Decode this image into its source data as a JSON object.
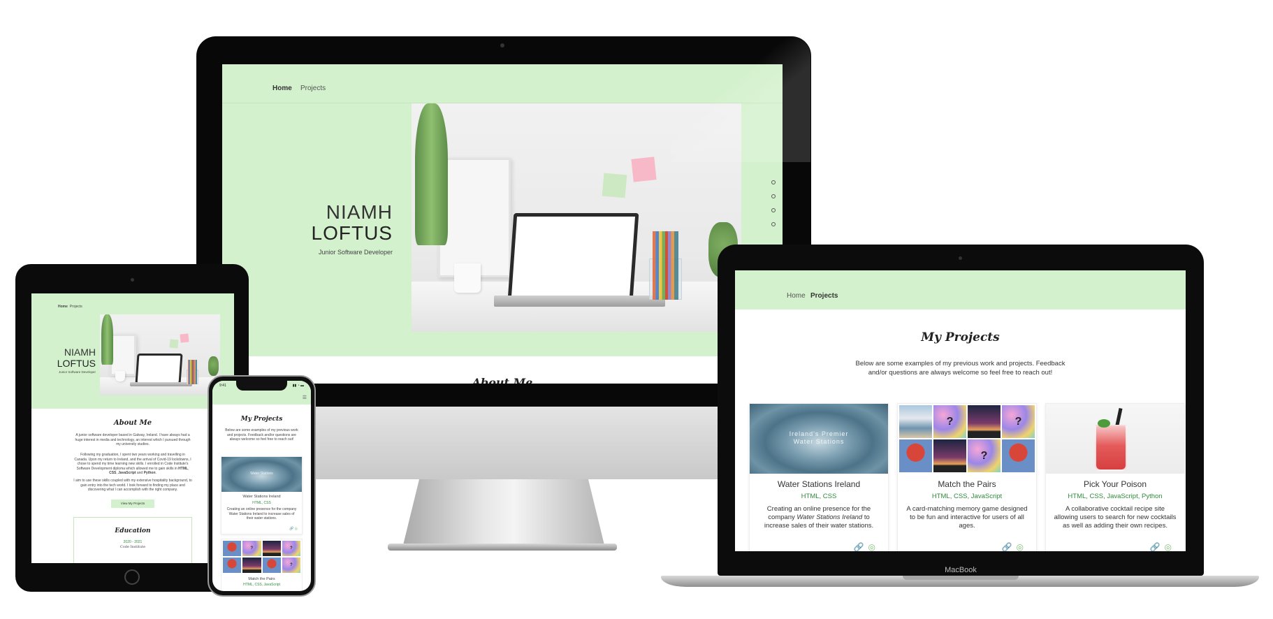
{
  "imac": {
    "nav": {
      "home": "Home",
      "projects": "Projects"
    },
    "hero": {
      "first_name": "NIAMH",
      "last_name": "LOFTUS",
      "tagline": "Junior Software Developer"
    },
    "below_title": "About Me"
  },
  "macbook": {
    "nav": {
      "home": "Home",
      "projects": "Projects"
    },
    "section_title": "My Projects",
    "intro_line1": "Below are some examples of my previous work and projects. Feedback",
    "intro_line2": "and/or questions are always welcome so feel free to reach out!",
    "brand_label": "MacBook",
    "cards": [
      {
        "thumb_text_line1": "Ireland's Premier",
        "thumb_text_line2": "Water Stations",
        "title": "Water Stations Ireland",
        "tech": "HTML, CSS",
        "desc_part1": "Creating an online presence for the company ",
        "desc_em": "Water Stations Ireland",
        "desc_part2": " to increase sales of their water stations."
      },
      {
        "title": "Match the Pairs",
        "tech": "HTML, CSS, JavaScript",
        "desc": "A card-matching memory game designed to be fun and interactive for users of all ages.",
        "tile_mark": "?"
      },
      {
        "title": "Pick Your Poison",
        "tech": "HTML, CSS, JavaScript, Python",
        "desc": "A collaborative cocktail recipe site allowing users to search for new cocktails as well as adding their own recipes."
      }
    ],
    "card_icons": {
      "link": "🔗",
      "github": "◎"
    }
  },
  "ipad": {
    "nav": {
      "home": "Home",
      "projects": "Projects"
    },
    "hero": {
      "first_name": "NIAMH",
      "last_name": "LOFTUS",
      "tagline": "Junior Software Developer"
    },
    "about_title": "About Me",
    "about_p1": "A junior software developer based in Galway, Ireland. I have always had a huge interest in media and technology, an interest which I pursued through my university studies.",
    "about_p2_a": "Following my graduation, I spent two years working and travelling in Canada. Upon my return to Ireland, and the arrival of Covid-19 lockdowns, I chose to spend my time learning new skills. I enrolled in Code Institute's Software Development diploma which allowed me to gain skills in ",
    "about_p2_html": "HTML",
    "about_p2_sep1": ", ",
    "about_p2_css": "CSS",
    "about_p2_sep2": ", ",
    "about_p2_js": "JavaScript",
    "about_p2_and": " and ",
    "about_p2_py": "Python",
    "about_p2_end": ".",
    "about_p3": "I aim to use these skills coupled with my extensive hospitality background, to gain entry into the tech world. I look forward to finding my place and discovering what I can accomplish with the right company.",
    "button": "View My Projects",
    "education_title": "Education",
    "education_years": "2020 - 2021",
    "education_school": "Code Institute"
  },
  "iphone": {
    "status_time": "9:41",
    "status_icons": "▮▮ ◔ ▬",
    "menu_icon": "☰",
    "section_title": "My Projects",
    "intro": "Below are some examples of my previous work and projects. Feedback and/or questions are always welcome so feel free to reach out!",
    "card1": {
      "thumb_text": "Water Stations",
      "title": "Water Stations Ireland",
      "tech": "HTML, CSS",
      "desc": "Creating an online presence for the company Water Stations Ireland to increase sales of their water stations.",
      "icons": "🔗 ◎"
    },
    "card2": {
      "title": "Match the Pairs",
      "tech": "HTML, CSS, JavaScript",
      "tile_mark": "?"
    }
  },
  "colors": {
    "mint": "#d4f1cd",
    "accent_green": "#2e8b3a",
    "icon_green": "#7dbf73"
  }
}
